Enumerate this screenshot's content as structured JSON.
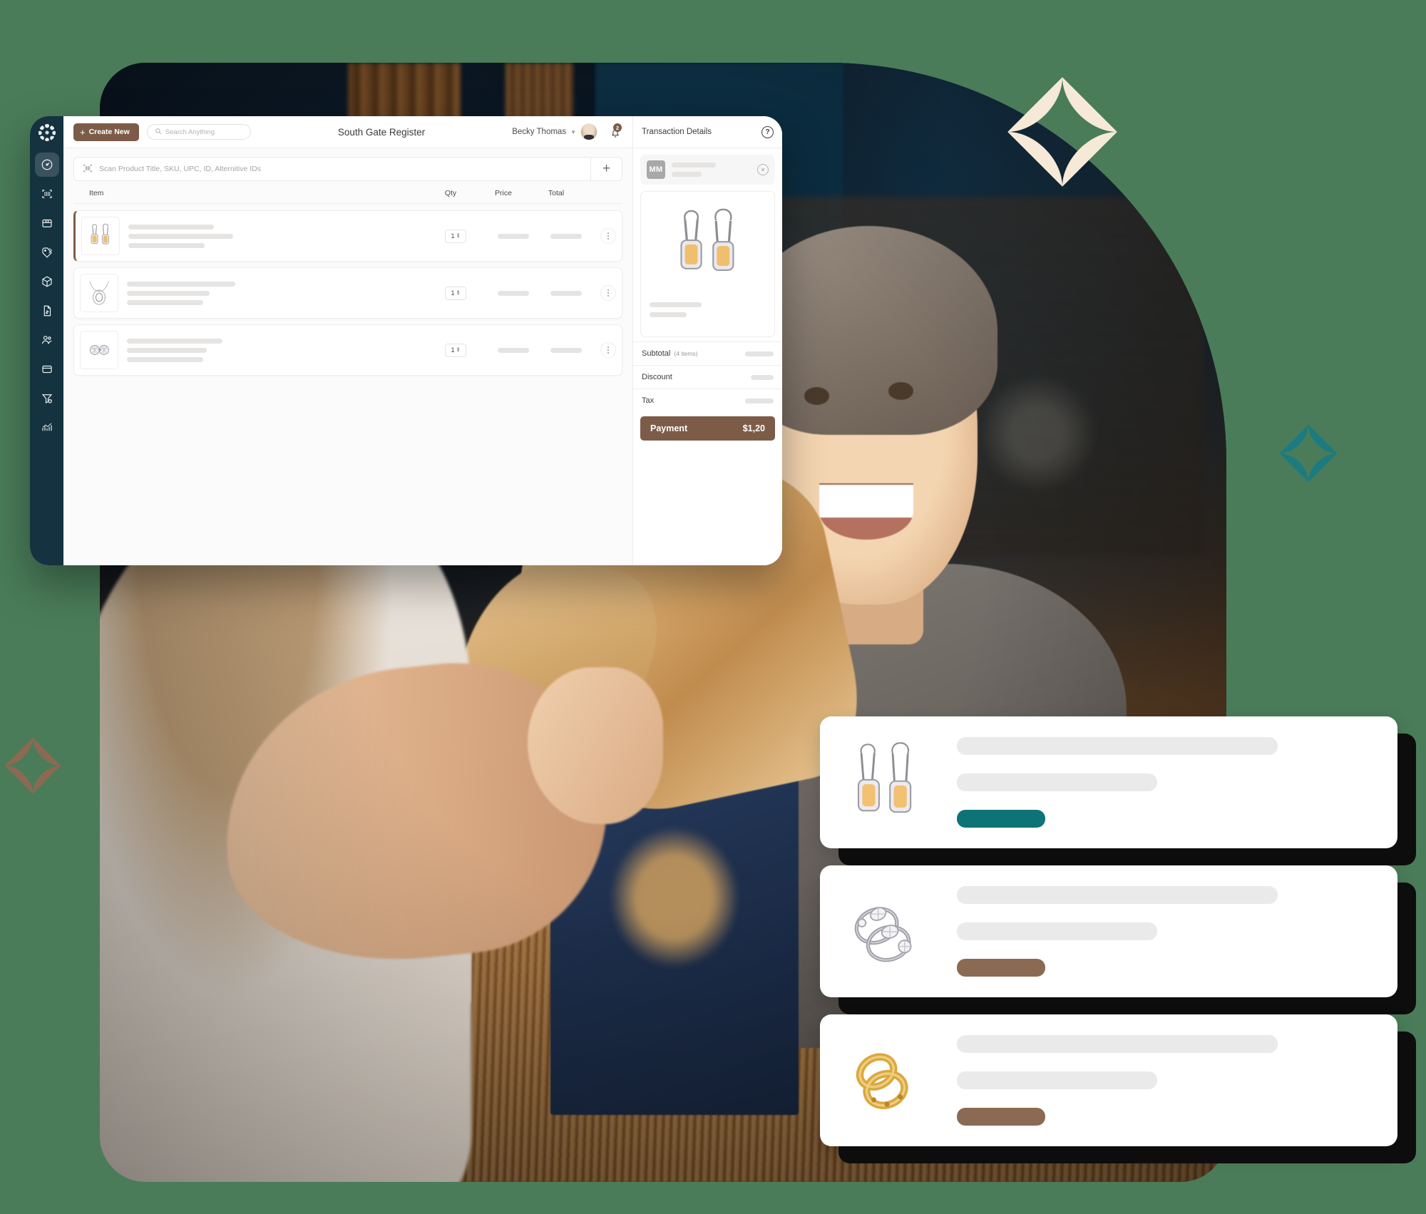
{
  "app": {
    "toolbar": {
      "create_new_label": "Create New",
      "search_placeholder": "Search Anything",
      "register_title": "South Gate Register",
      "user_name": "Becky Thomas",
      "notification_count": "2"
    },
    "scan": {
      "placeholder": "Scan Product Title, SKU, UPC, ID, Alternitive IDs",
      "add_label": "+"
    },
    "table": {
      "columns": [
        "Item",
        "Qty",
        "Price",
        "Total"
      ],
      "rows": [
        {
          "thumb": "citrine-drop-earrings",
          "qty": "1"
        },
        {
          "thumb": "diamond-halo-pendant-necklace",
          "qty": "1"
        },
        {
          "thumb": "diamond-stud-earrings",
          "qty": "1"
        }
      ]
    },
    "transaction": {
      "title": "Transaction Details",
      "help_label": "?",
      "customer_initials": "MM",
      "customer_remove_label": "×",
      "preview_thumb": "citrine-drop-earrings",
      "totals": [
        {
          "label": "Subtotal",
          "note": "(4 items)"
        },
        {
          "label": "Discount",
          "note": ""
        },
        {
          "label": "Tax",
          "note": ""
        }
      ],
      "payment_label": "Payment",
      "payment_amount": "$1,20"
    },
    "sidebar": {
      "items": [
        {
          "icon": "dashboard-gauge-icon",
          "active": true
        },
        {
          "icon": "barcode-scan-icon",
          "active": false
        },
        {
          "icon": "register-drawer-icon",
          "active": false
        },
        {
          "icon": "tags-icon",
          "active": false
        },
        {
          "icon": "box-cube-icon",
          "active": false
        },
        {
          "icon": "invoice-document-icon",
          "active": false
        },
        {
          "icon": "customers-icon",
          "active": false
        },
        {
          "icon": "window-panel-icon",
          "active": false
        },
        {
          "icon": "funnel-filter-icon",
          "active": false
        },
        {
          "icon": "analytics-chart-icon",
          "active": false
        }
      ]
    }
  },
  "product_cards": [
    {
      "thumb": "citrine-drop-earrings",
      "badge_color": "#0d7377"
    },
    {
      "thumb": "diamond-cluster-rings",
      "badge_color": "#8a6a52"
    },
    {
      "thumb": "gold-band-rings",
      "badge_color": "#8a6a52"
    }
  ],
  "decor": {
    "sparkles": [
      {
        "name": "sparkle-cream",
        "color": "#f6e9d8"
      },
      {
        "name": "sparkle-teal",
        "color": "#1b7b80"
      },
      {
        "name": "sparkle-brown",
        "color": "#8a6a52"
      }
    ],
    "background_color": "#4a7c59"
  }
}
